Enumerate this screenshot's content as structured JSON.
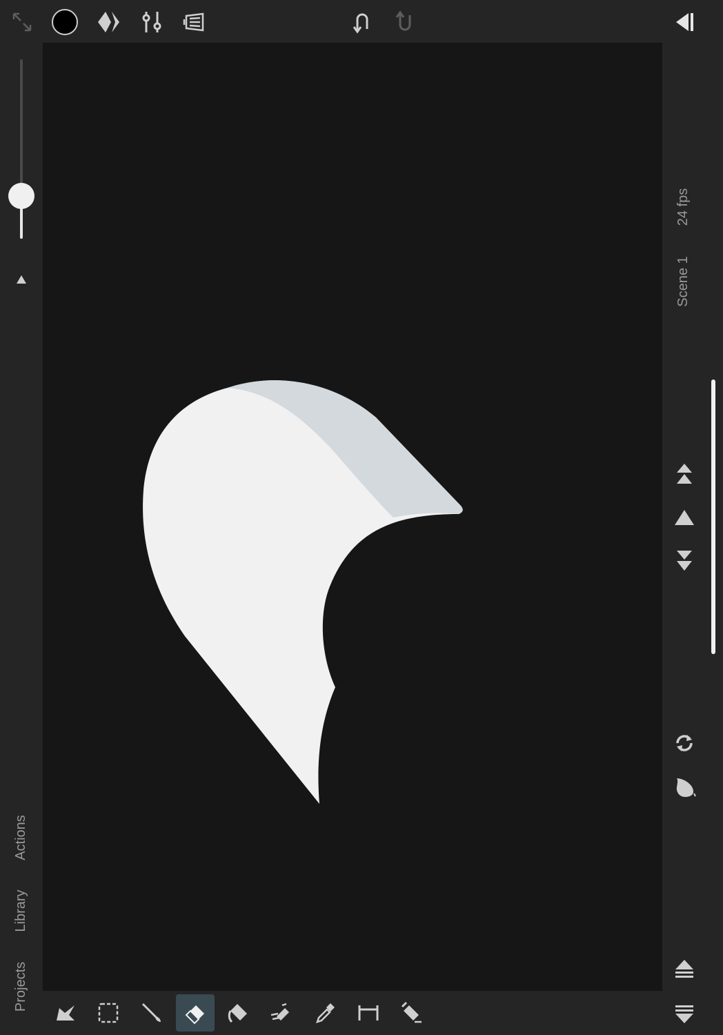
{
  "top_toolbar": {
    "icons": [
      "fullscreen-icon",
      "color-swatch-icon",
      "layers-diamond-icon",
      "adjust-sliders-icon",
      "reference-icon",
      "undo-icon",
      "redo-icon",
      "collapse-panel-icon"
    ],
    "color_swatch": "#000000"
  },
  "left_panel": {
    "brush_size_level": 0.24,
    "tabs": {
      "actions": "Actions",
      "library": "Library",
      "projects": "Projects"
    }
  },
  "right_panel": {
    "fps_label": "24 fps",
    "scene_label": "Scene 1",
    "icons": [
      "add-frame-above-icon",
      "previous-frame-icon",
      "next-frame-icon",
      "loop-icon",
      "onion-skin-icon",
      "move-up-icon",
      "move-down-icon"
    ]
  },
  "bottom_toolbar": {
    "tools": [
      "select-arrow-icon",
      "marquee-select-icon",
      "brush-icon",
      "eraser-icon",
      "fill-bucket-icon",
      "smudge-icon",
      "eyedropper-icon",
      "ruler-icon",
      "pen-icon"
    ],
    "active_tool": "eraser"
  },
  "colors": {
    "panel_bg": "#252526",
    "canvas_bg": "#161617",
    "shape_fill": "#f1f1f1",
    "shape_shade": "#d3d9dd",
    "active_tool_bg": "#3a4a52"
  }
}
